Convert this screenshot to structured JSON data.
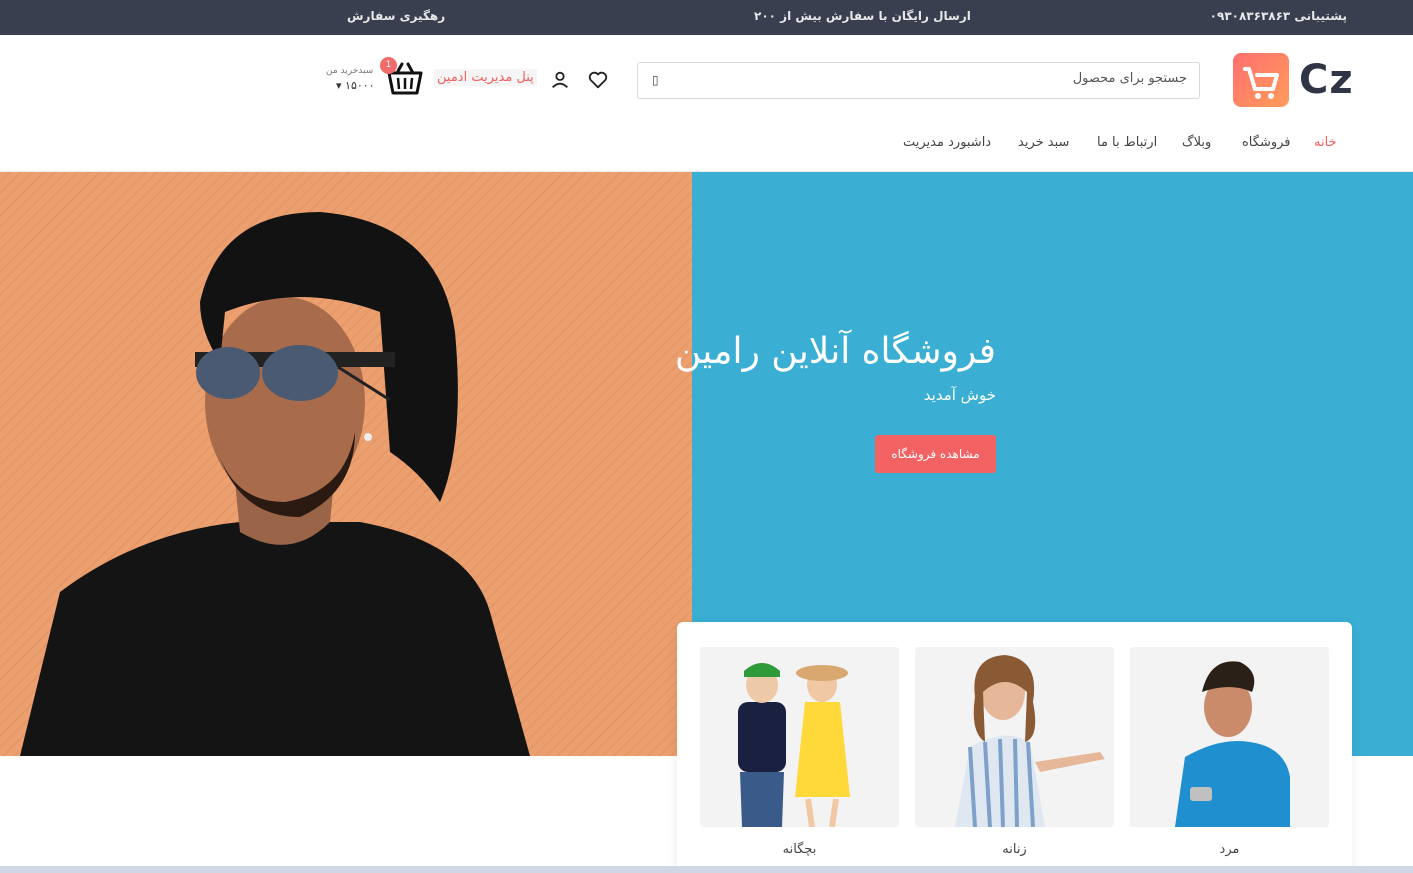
{
  "topbar": {
    "support": "پشتیبانی ۰۹۳۰۸۳۶۳۸۶۳",
    "shipping": "ارسال رایگان با سفارش بیش از ۲۰۰",
    "tracking": "رهگیری سفارش"
  },
  "header": {
    "logo_text": "Cz",
    "search": {
      "placeholder": "جستجو برای محصول"
    },
    "admin_panel": "پنل مدیریت ادمین",
    "cart": {
      "badge": "1",
      "label": "سبدخرید من",
      "total": "۱۵۰۰۰"
    }
  },
  "nav": {
    "items": [
      {
        "label": "خانه",
        "active": true
      },
      {
        "label": "فروشگاه"
      },
      {
        "label": "وبلاگ"
      },
      {
        "label": "ارتباط با ما"
      },
      {
        "label": "سبد خرید"
      },
      {
        "label": "داشبورد مدیریت"
      }
    ]
  },
  "hero": {
    "title": "فروشگاه آنلاین رامین",
    "subtitle": "خوش آمدید",
    "button": "مشاهده فروشگاه"
  },
  "categories": [
    {
      "label": "مرد"
    },
    {
      "label": "زنانه"
    },
    {
      "label": "بچگانه"
    }
  ],
  "colors": {
    "topbar": "#3a3f4f",
    "accent": "#f26262",
    "hero_left": "#eca06f",
    "hero_right": "#3aaed3"
  }
}
